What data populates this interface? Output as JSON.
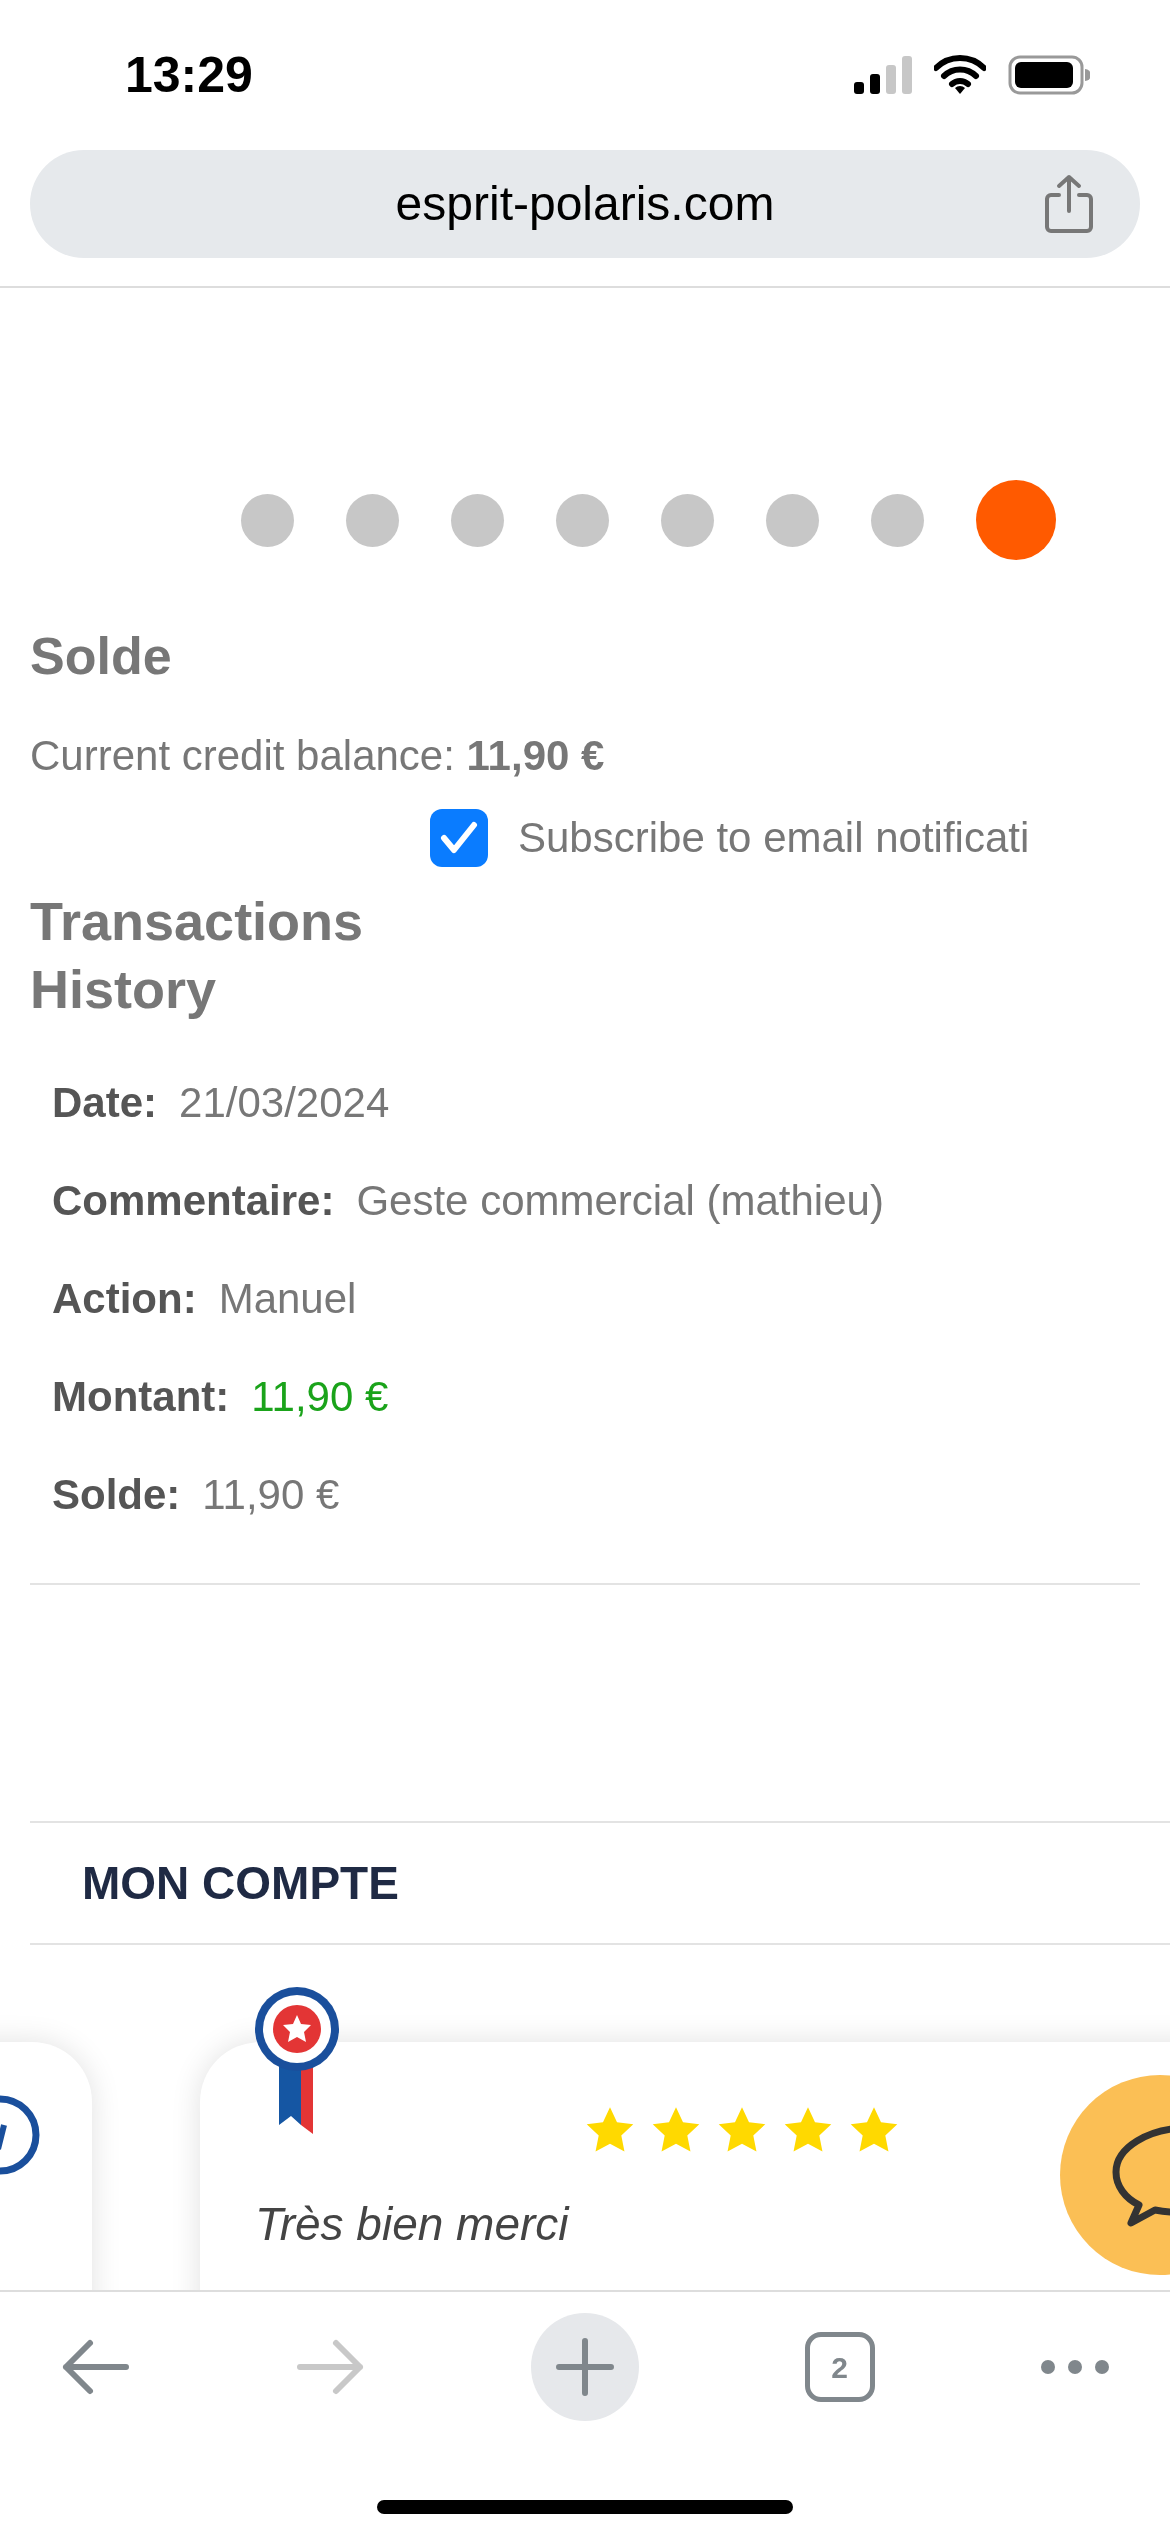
{
  "status_bar": {
    "time": "13:29"
  },
  "browser": {
    "url": "esprit-polaris.com",
    "tab_count": "2",
    "back_disabled": false,
    "forward_disabled": true
  },
  "carousel": {
    "dots": [
      {
        "selected": false
      },
      {
        "selected": false
      },
      {
        "selected": false
      },
      {
        "selected": false
      },
      {
        "selected": false
      },
      {
        "selected": false
      },
      {
        "selected": false
      },
      {
        "selected": true
      }
    ]
  },
  "balance": {
    "heading": "Solde",
    "text": "Current credit balance: **11,90 €**"
  },
  "email_subscription": {
    "label": "Subscribe to email notificati",
    "checked": true
  },
  "transactions": {
    "heading": "Transactions History",
    "rows": [
      {
        "fields": [
          {
            "label": "Date:",
            "value": "21/03/2024",
            "kind": "plain"
          },
          {
            "label": "Commentaire:",
            "value": "Geste commercial (mathieu)",
            "kind": "plain"
          },
          {
            "label": "Action:",
            "value": "Manuel",
            "kind": "plain"
          },
          {
            "label": "Montant:",
            "value": "11,90 €",
            "kind": "credit"
          },
          {
            "label": "Solde:",
            "value": "11,90 €",
            "kind": "plain"
          }
        ]
      }
    ]
  },
  "account_section": {
    "title": "MON COMPTE"
  },
  "reviews": [
    {
      "stars": 5,
      "text": "Très bien merci"
    }
  ]
}
